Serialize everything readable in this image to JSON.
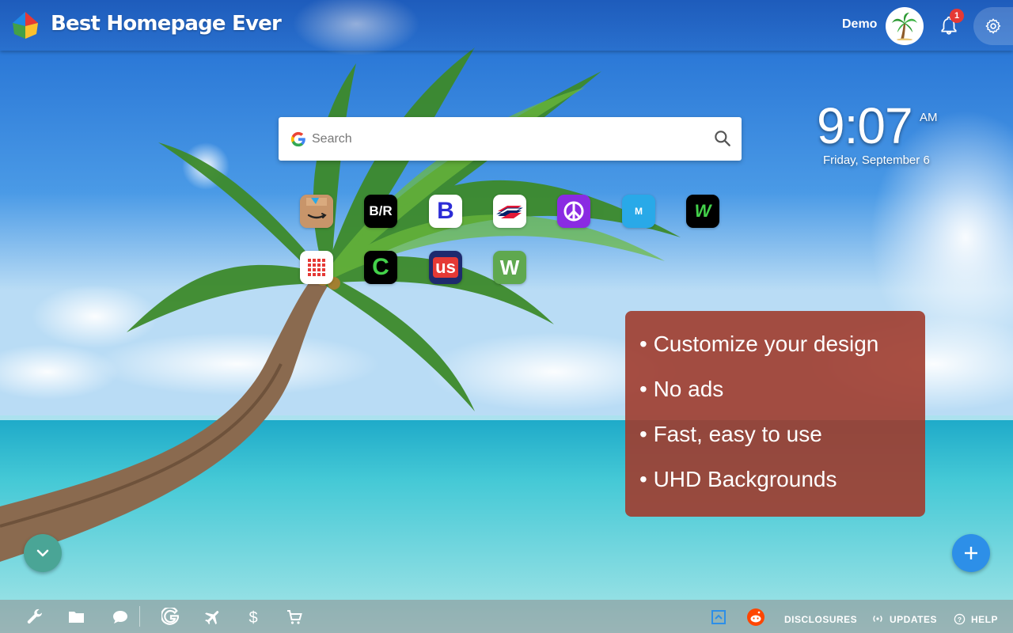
{
  "header": {
    "brand": "Best Homepage Ever",
    "user_name": "Demo",
    "avatar_icon": "palm-tree-icon",
    "notification_count": "1"
  },
  "search": {
    "placeholder": "Search"
  },
  "clock": {
    "time": "9:07",
    "ampm": "AM",
    "date": "Friday, September 6"
  },
  "shortcuts": [
    {
      "name": "amazon",
      "icon": "amazon-box-icon",
      "color": "#c8956a"
    },
    {
      "name": "bleacher-report",
      "label": "B/R",
      "color": "#000000"
    },
    {
      "name": "booking",
      "label": "B",
      "color": "#ffffff"
    },
    {
      "name": "bank-of-america",
      "icon": "bofa-flag-icon",
      "color": "#ffffff"
    },
    {
      "name": "peace",
      "icon": "peace-sign-icon",
      "color": "#8a2be2"
    },
    {
      "name": "m-app",
      "label": "M",
      "color": "#29a9e8"
    },
    {
      "name": "w-app-dark",
      "label": "W",
      "color": "#000000"
    },
    {
      "name": "grid-app",
      "icon": "grid-dots-icon",
      "color": "#ffffff"
    },
    {
      "name": "c-app",
      "label": "C",
      "color": "#000000"
    },
    {
      "name": "usa-today",
      "label": "us",
      "color": "#1e2a6e"
    },
    {
      "name": "w-app-green",
      "label": "W",
      "color": "#5fa84f"
    }
  ],
  "promo": {
    "items": [
      "• Customize your design",
      "• No ads",
      "• Fast, easy to use",
      "• UHD Backgrounds"
    ]
  },
  "footer": {
    "tools": [
      "wrench-icon",
      "folder-icon",
      "chat-icon",
      "google-icon",
      "plane-icon",
      "dollar-icon",
      "cart-icon"
    ],
    "disclosures": "DISCLOSURES",
    "updates": "UPDATES",
    "help": "HELP"
  }
}
